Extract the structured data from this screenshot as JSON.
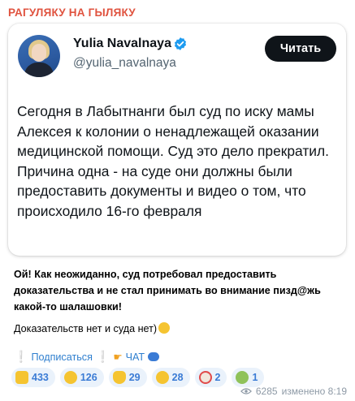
{
  "channel": {
    "name": "РАГУЛЯКУ НА ГЫЛЯКУ"
  },
  "tweet": {
    "author_name": "Yulia Navalnaya",
    "author_handle": "@yulia_navalnaya",
    "read_label": "Читать",
    "text": "Сегодня в Лабытнанги был суд по иску мамы Алексея к колонии о ненадлежащей оказании медицинской помощи. Суд это дело прекратил. Причина одна - на суде они должны были предоставить документы и видео о том, что происходило 16-го февраля"
  },
  "post": {
    "comment": "Ой! Как неожиданно, суд потребовал предоставить доказательства и не стал принимать во внимание пизд@жь какой-то шалашовки!",
    "comment2": "Доказательств нет и суда нет)",
    "subscribe_label": "Подписаться",
    "chat_label": "ЧАТ"
  },
  "reactions": [
    {
      "icon": "thumbs-up-icon",
      "count": "433"
    },
    {
      "icon": "grinning-face-icon",
      "count": "126"
    },
    {
      "icon": "victory-hand-icon",
      "count": "29"
    },
    {
      "icon": "laughing-face-icon",
      "count": "28"
    },
    {
      "icon": "clown-face-icon",
      "count": "2"
    },
    {
      "icon": "zombie-icon",
      "count": "1"
    }
  ],
  "meta": {
    "views": "6285",
    "status": "изменено 8:19"
  },
  "colors": {
    "channel": "#e0533f",
    "link": "#2f7fcf",
    "reaction_bg": "#eaf2fb",
    "verified": "#1d9bf0"
  }
}
